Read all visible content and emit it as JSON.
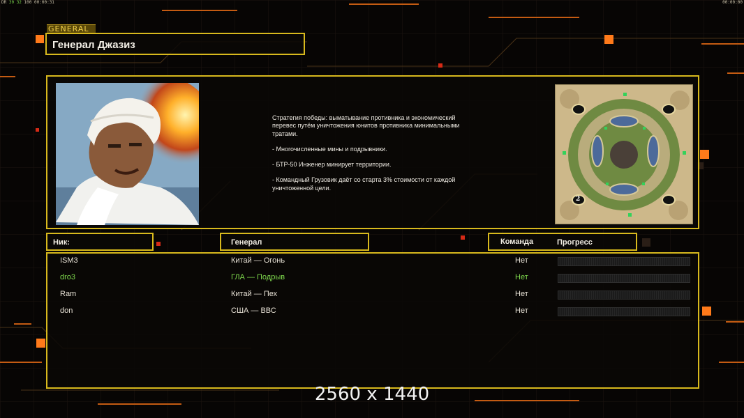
{
  "hud": {
    "left_prefix": "DR",
    "left_green": "30 32",
    "left_mid": "100",
    "left_time": "00:00:31",
    "right_time": "00:00:00"
  },
  "screen_tag": "GENERAL",
  "general_name": "Генерал Джазиз",
  "portrait_icon": "general-portrait",
  "minimap_icon": "map-preview",
  "minimap_player_number": "2",
  "description": {
    "strategy": "Стратегия победы: выматывание противника и экономический\n перевес путём уничтожения юнитов противника минимальными\n тратами.",
    "bullet1": "- Многочисленные мины и подрывники.",
    "bullet2": "- БТР-50 Инженер минирует территории.",
    "bullet3": "- Командный Грузовик даёт со старта 3% стоимости от каждой\n уничтоженной цели."
  },
  "headers": {
    "nick": "Ник:",
    "general": "Генерал",
    "team": "Команда",
    "progress": "Прогресс"
  },
  "players": [
    {
      "nick": "ISM3",
      "general": "Китай — Огонь",
      "team": "Нет",
      "progress": 0,
      "color": "#e8e2d6"
    },
    {
      "nick": "dro3",
      "general": "ГЛА — Подрыв",
      "team": "Нет",
      "progress": 0,
      "color": "#7ed84d"
    },
    {
      "nick": "Ram",
      "general": "Китай — Пех",
      "team": "Нет",
      "progress": 0,
      "color": "#e8e2d6"
    },
    {
      "nick": "don",
      "general": "США — ВВС",
      "team": "Нет",
      "progress": 0,
      "color": "#e8e2d6"
    }
  ],
  "watermark": "2560 x 1440",
  "colors": {
    "accent": "#d8b91d",
    "background": "#070504",
    "glow": "#ff7a1a"
  }
}
